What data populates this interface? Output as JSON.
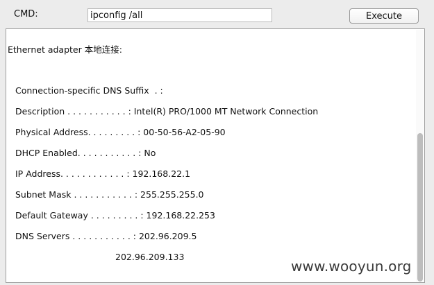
{
  "command": {
    "label": "CMD:",
    "value": "ipconfig /all",
    "execute_label": "Execute"
  },
  "output": {
    "header": "Ethernet adapter 本地连接:",
    "lines": [
      "Connection-specific DNS Suffix  . :",
      "Description . . . . . . . . . . . : Intel(R) PRO/1000 MT Network Connection",
      "Physical Address. . . . . . . . . : 00-50-56-A2-05-90",
      "DHCP Enabled. . . . . . . . . . . : No",
      "IP Address. . . . . . . . . . . . : 192.168.22.1",
      "Subnet Mask . . . . . . . . . . . : 255.255.255.0",
      "Default Gateway . . . . . . . . . : 192.168.22.253",
      "DNS Servers . . . . . . . . . . . : 202.96.209.5",
      "202.96.209.133"
    ]
  },
  "watermark": "www.wooyun.org"
}
